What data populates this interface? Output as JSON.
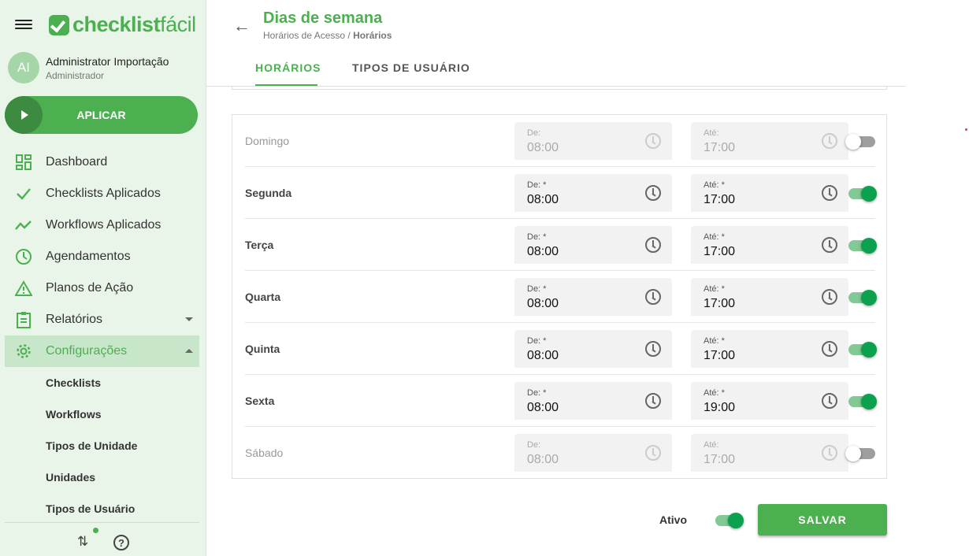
{
  "brand": {
    "logo_bold": "checklist",
    "logo_light": "fácil",
    "color": "#4caf50"
  },
  "user": {
    "initials": "AI",
    "name": "Administrator Importação",
    "role": "Administrador"
  },
  "apply_button": "APLICAR",
  "nav": {
    "dashboard": "Dashboard",
    "checklists": "Checklists Aplicados",
    "workflows": "Workflows Aplicados",
    "agendamentos": "Agendamentos",
    "planos": "Planos de Ação",
    "relatorios": "Relatórios",
    "config": "Configurações"
  },
  "subnav": [
    "Checklists",
    "Workflows",
    "Tipos de Unidade",
    "Unidades",
    "Tipos de Usuário"
  ],
  "page": {
    "title": "Dias de semana",
    "breadcrumb_parent": "Horários de Acesso /",
    "breadcrumb_current": "Horários"
  },
  "tabs": [
    "HORÁRIOS",
    "TIPOS DE USUÁRIO"
  ],
  "days": [
    {
      "name": "Domingo",
      "enabled": false,
      "from_label": "De:",
      "from": "08:00",
      "to_label": "Até:",
      "to": "17:00"
    },
    {
      "name": "Segunda",
      "enabled": true,
      "from_label": "De: *",
      "from": "08:00",
      "to_label": "Até: *",
      "to": "17:00"
    },
    {
      "name": "Terça",
      "enabled": true,
      "from_label": "De: *",
      "from": "08:00",
      "to_label": "Até: *",
      "to": "17:00"
    },
    {
      "name": "Quarta",
      "enabled": true,
      "from_label": "De: *",
      "from": "08:00",
      "to_label": "Até: *",
      "to": "17:00"
    },
    {
      "name": "Quinta",
      "enabled": true,
      "from_label": "De: *",
      "from": "08:00",
      "to_label": "Até: *",
      "to": "17:00"
    },
    {
      "name": "Sexta",
      "enabled": true,
      "from_label": "De: *",
      "from": "08:00",
      "to_label": "Até: *",
      "to": "19:00"
    },
    {
      "name": "Sábado",
      "enabled": false,
      "from_label": "De:",
      "from": "08:00",
      "to_label": "Até:",
      "to": "17:00"
    }
  ],
  "footer": {
    "active_label": "Ativo",
    "active": true,
    "save_label": "SALVAR"
  }
}
